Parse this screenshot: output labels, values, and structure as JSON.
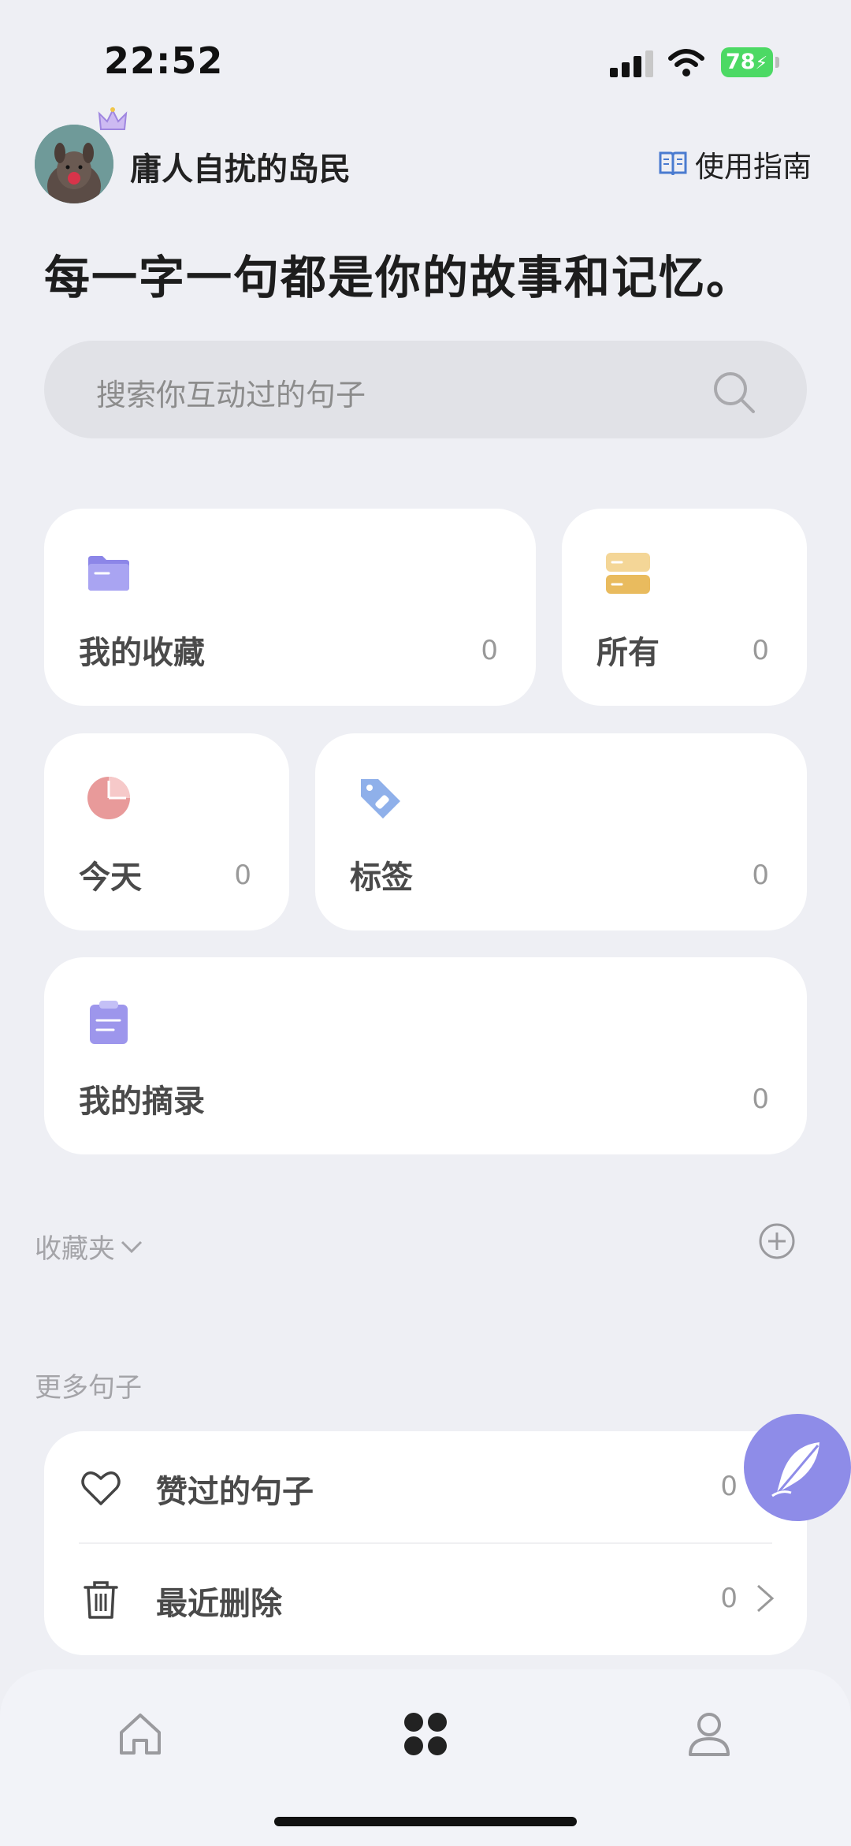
{
  "status_bar": {
    "time": "22:52",
    "battery": "78"
  },
  "header": {
    "username": "庸人自扰的岛民",
    "guide_label": "使用指南",
    "headline": "每一字一句都是你的故事和记忆。"
  },
  "search": {
    "placeholder": "搜索你互动过的句子"
  },
  "cards": {
    "favorites": {
      "label": "我的收藏",
      "count": "0",
      "icon": "folder-icon"
    },
    "all": {
      "label": "所有",
      "count": "0",
      "icon": "stack-icon"
    },
    "today": {
      "label": "今天",
      "count": "0",
      "icon": "pie-chart-icon"
    },
    "tags": {
      "label": "标签",
      "count": "0",
      "icon": "tag-icon"
    },
    "excerpts": {
      "label": "我的摘录",
      "count": "0",
      "icon": "clipboard-icon"
    }
  },
  "folders": {
    "title": "收藏夹"
  },
  "more": {
    "title": "更多句子",
    "items": [
      {
        "label": "赞过的句子",
        "count": "0",
        "icon": "heart-icon"
      },
      {
        "label": "最近删除",
        "count": "0",
        "icon": "trash-icon"
      }
    ]
  },
  "tabbar": {
    "items": [
      "home-icon",
      "grid-icon",
      "person-icon"
    ],
    "active": 1
  },
  "colors": {
    "accent": "#8E8CE8",
    "background": "#EEEFF4",
    "card": "#FFFFFF"
  }
}
